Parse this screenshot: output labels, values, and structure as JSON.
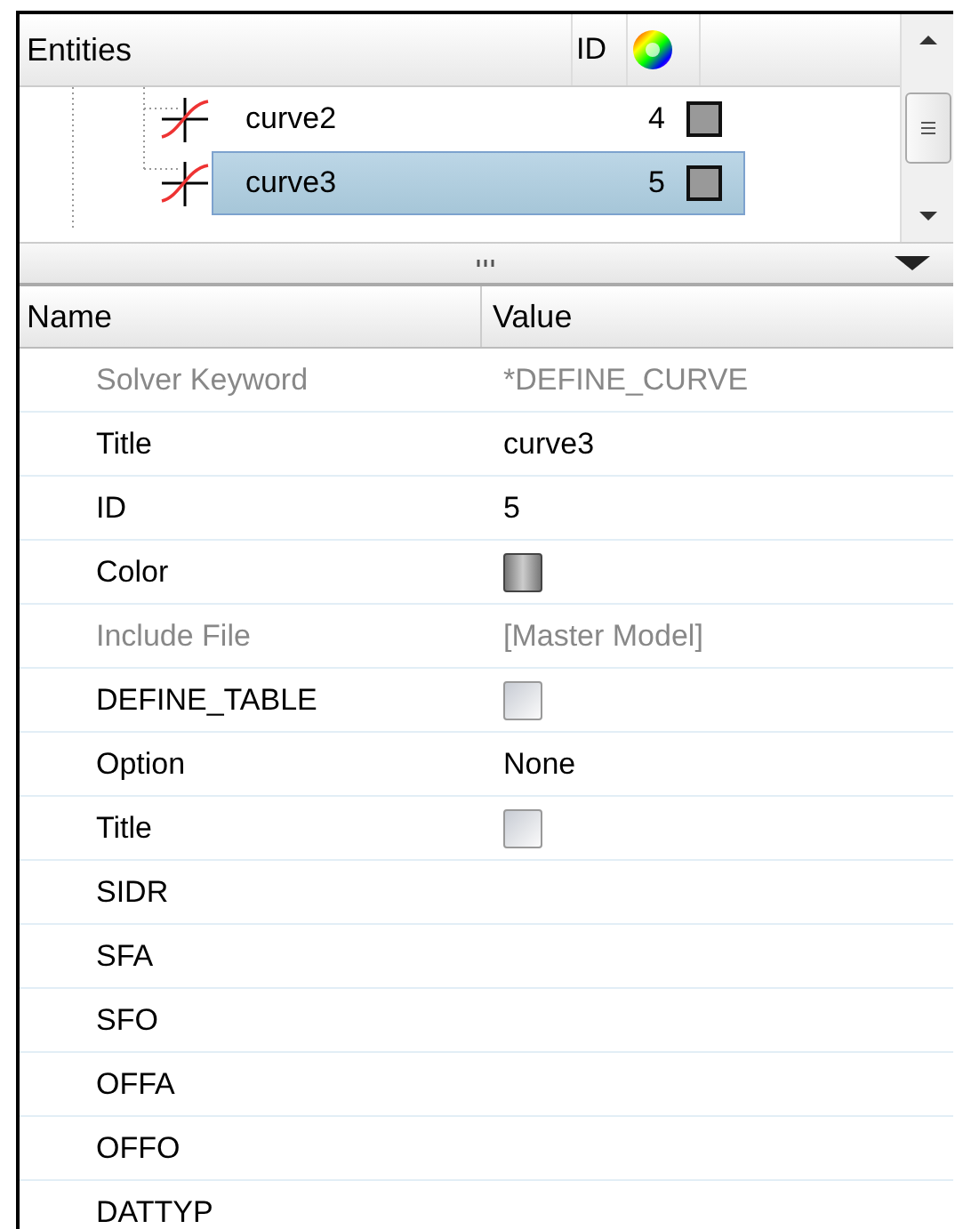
{
  "entity_tree": {
    "columns": {
      "entities": "Entities",
      "id": "ID"
    },
    "rows": [
      {
        "name": "curve2",
        "id": "4",
        "selected": false
      },
      {
        "name": "curve3",
        "id": "5",
        "selected": true
      }
    ]
  },
  "properties": {
    "columns": {
      "name": "Name",
      "value": "Value"
    },
    "rows": [
      {
        "name": "Solver Keyword",
        "kind": "text",
        "value": "*DEFINE_CURVE",
        "disabled": true
      },
      {
        "name": "Title",
        "kind": "text",
        "value": "curve3",
        "disabled": false
      },
      {
        "name": "ID",
        "kind": "text",
        "value": "5",
        "disabled": false
      },
      {
        "name": "Color",
        "kind": "color",
        "disabled": false
      },
      {
        "name": "Include File",
        "kind": "text",
        "value": "[Master Model]",
        "disabled": true
      },
      {
        "name": "DEFINE_TABLE",
        "kind": "checkbox",
        "checked": false,
        "disabled": false
      },
      {
        "name": "Option",
        "kind": "text",
        "value": "None",
        "disabled": false
      },
      {
        "name": "Title",
        "kind": "checkbox",
        "checked": false,
        "disabled": false
      },
      {
        "name": "SIDR",
        "kind": "empty",
        "disabled": false
      },
      {
        "name": "SFA",
        "kind": "empty",
        "disabled": false
      },
      {
        "name": "SFO",
        "kind": "empty",
        "disabled": false
      },
      {
        "name": "OFFA",
        "kind": "empty",
        "disabled": false
      },
      {
        "name": "OFFO",
        "kind": "empty",
        "disabled": false
      },
      {
        "name": "DATTYP",
        "kind": "empty",
        "disabled": false
      }
    ]
  }
}
